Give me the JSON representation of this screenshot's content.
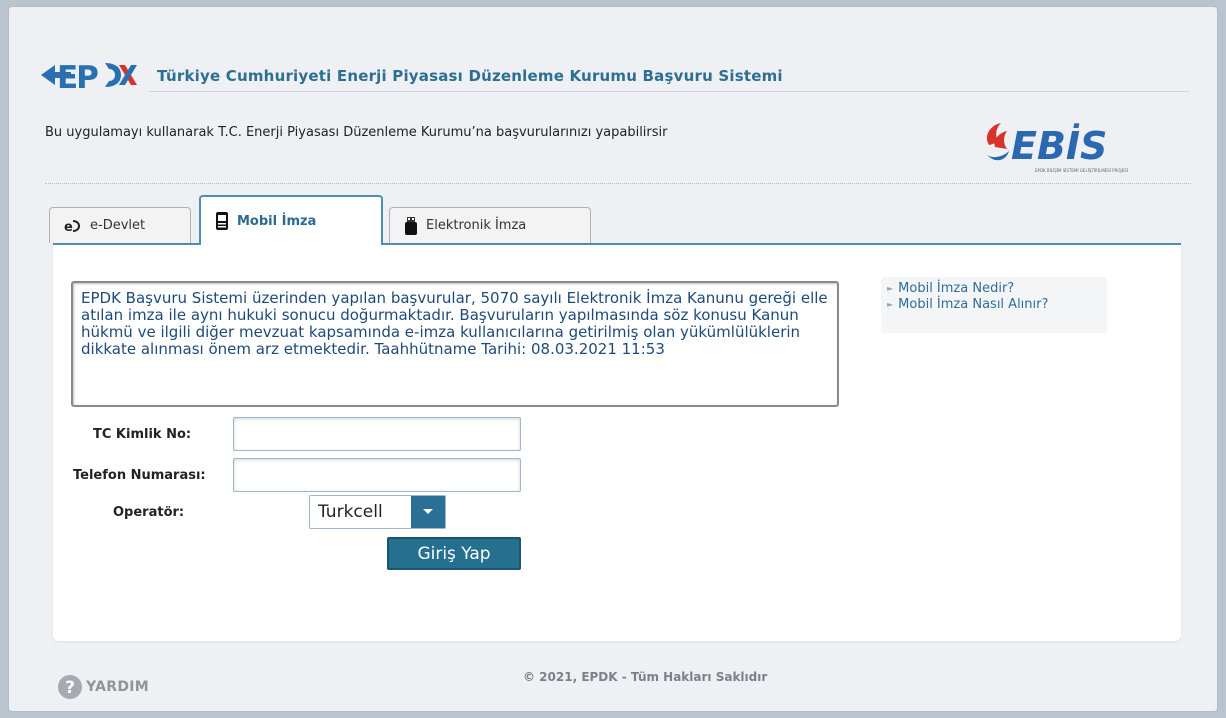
{
  "header": {
    "logo_text": "EPDK",
    "title": "Türkiye Cumhuriyeti Enerji Piyasası Düzenleme Kurumu Başvuru Sistemi",
    "intro": "Bu uygulamayı kullanarak T.C. Enerji Piyasası Düzenleme Kurumu’na başvurularınızı yapabilirsir",
    "ebis_logo_text": "EBİS",
    "ebis_logo_subtext": "EPDK BİLİŞİM SİSTEMİ GELİŞTİRİLMESİ PROJESİ"
  },
  "tabs": [
    {
      "label": "e-Devlet",
      "icon": "edevlet-icon",
      "active": false
    },
    {
      "label": "Mobil İmza",
      "icon": "mobile-phone-icon",
      "active": true
    },
    {
      "label": "Elektronik İmza",
      "icon": "usb-token-icon",
      "active": false
    }
  ],
  "notice": "EPDK Başvuru Sistemi üzerinden yapılan başvurular,  5070 sayılı Elektronik İmza Kanunu gereği elle atılan imza ile aynı hukuki sonucu doğurmaktadır. Başvuruların yapılmasında söz konusu Kanun hükmü ve ilgili diğer mevzuat kapsamında e-imza kullanıcılarına getirilmiş olan yükümlülüklerin dikkate alınması önem arz etmektedir. Taahhütname Tarihi: 08.03.2021 11:53",
  "side_links": [
    {
      "label": "Mobil İmza Nedir?"
    },
    {
      "label": "Mobil İmza Nasıl Alınır?"
    }
  ],
  "form": {
    "tc_label": "TC Kimlik No:",
    "tc_value": "",
    "phone_label": "Telefon Numarası:",
    "phone_value": "",
    "operator_label": "Operatör:",
    "operator_value": "Turkcell",
    "submit_label": "Giriş Yap"
  },
  "footer": {
    "help_label": "YARDIM",
    "copyright": "© 2021, EPDK - Tüm Hakları Saklıdır"
  },
  "colors": {
    "accent": "#4d8eb4",
    "button": "#26708f",
    "title": "#2d6f93",
    "ebis_red": "#d8332b",
    "ebis_blue": "#2a68b0"
  }
}
